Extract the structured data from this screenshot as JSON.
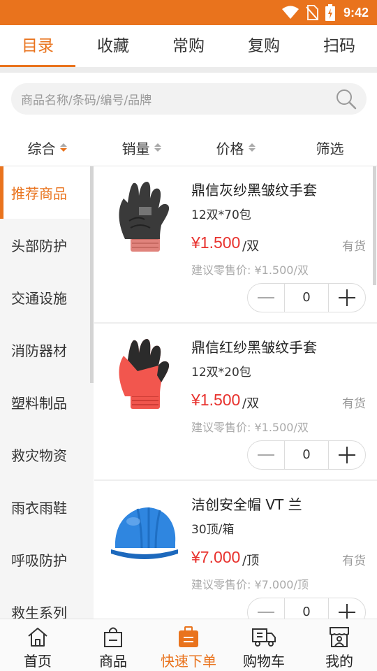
{
  "statusbar": {
    "time": "9:42",
    "icons": [
      "wifi-icon",
      "no-sim-icon",
      "battery-charging-icon"
    ]
  },
  "tabs": [
    {
      "label": "目录",
      "active": true
    },
    {
      "label": "收藏",
      "active": false
    },
    {
      "label": "常购",
      "active": false
    },
    {
      "label": "复购",
      "active": false
    },
    {
      "label": "扫码",
      "active": false
    }
  ],
  "search": {
    "placeholder": "商品名称/条码/编号/品牌",
    "icon": "search-icon"
  },
  "sort": [
    {
      "label": "综合",
      "active": true
    },
    {
      "label": "销量"
    },
    {
      "label": "价格"
    },
    {
      "label": "筛选"
    }
  ],
  "categories": [
    {
      "label": "推荐商品",
      "active": true
    },
    {
      "label": "头部防护"
    },
    {
      "label": "交通设施"
    },
    {
      "label": "消防器材"
    },
    {
      "label": "塑料制品"
    },
    {
      "label": "救灾物资"
    },
    {
      "label": "雨衣雨鞋"
    },
    {
      "label": "呼吸防护"
    },
    {
      "label": "救生系列"
    }
  ],
  "products": [
    {
      "name": "鼎信灰纱黑皱纹手套",
      "spec": "12双*70包",
      "price": "¥1.500",
      "unit": "/双",
      "stock": "有货",
      "suggested": "建议零售价: ¥1.500/双",
      "qty": "0",
      "image": "gray-black-glove"
    },
    {
      "name": "鼎信红纱黑皱纹手套",
      "spec": "12双*20包",
      "price": "¥1.500",
      "unit": "/双",
      "stock": "有货",
      "suggested": "建议零售价: ¥1.500/双",
      "qty": "0",
      "image": "red-black-glove"
    },
    {
      "name": "洁创安全帽 VT 兰",
      "spec": "30顶/箱",
      "price": "¥7.000",
      "unit": "/顶",
      "stock": "有货",
      "suggested": "建议零售价: ¥7.000/顶",
      "qty": "0",
      "image": "blue-safety-helmet"
    }
  ],
  "bottomnav": [
    {
      "label": "首页",
      "icon": "home-icon"
    },
    {
      "label": "商品",
      "icon": "shopping-bag-icon"
    },
    {
      "label": "快速下单",
      "icon": "quick-order-icon",
      "active": true
    },
    {
      "label": "购物车",
      "icon": "truck-cart-icon"
    },
    {
      "label": "我的",
      "icon": "store-user-icon"
    }
  ],
  "colors": {
    "accent": "#e9731d",
    "price": "#e8322e"
  }
}
